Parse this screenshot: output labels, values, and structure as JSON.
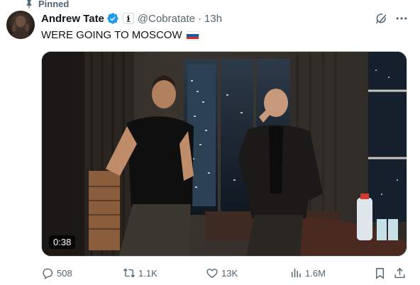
{
  "pinned": {
    "label": "Pinned"
  },
  "author": {
    "name": "Andrew Tate",
    "handle": "@Cobratate",
    "time": "13h"
  },
  "tweet": {
    "text": "WERE GOING TO MOSCOW"
  },
  "media": {
    "duration": "0:38"
  },
  "actions": {
    "replies": "508",
    "reposts": "1.1K",
    "likes": "13K",
    "views": "1.6M"
  },
  "colors": {
    "secondary_text": "#536471",
    "verified_blue": "#1d9bf0",
    "text": "#0f1419"
  }
}
